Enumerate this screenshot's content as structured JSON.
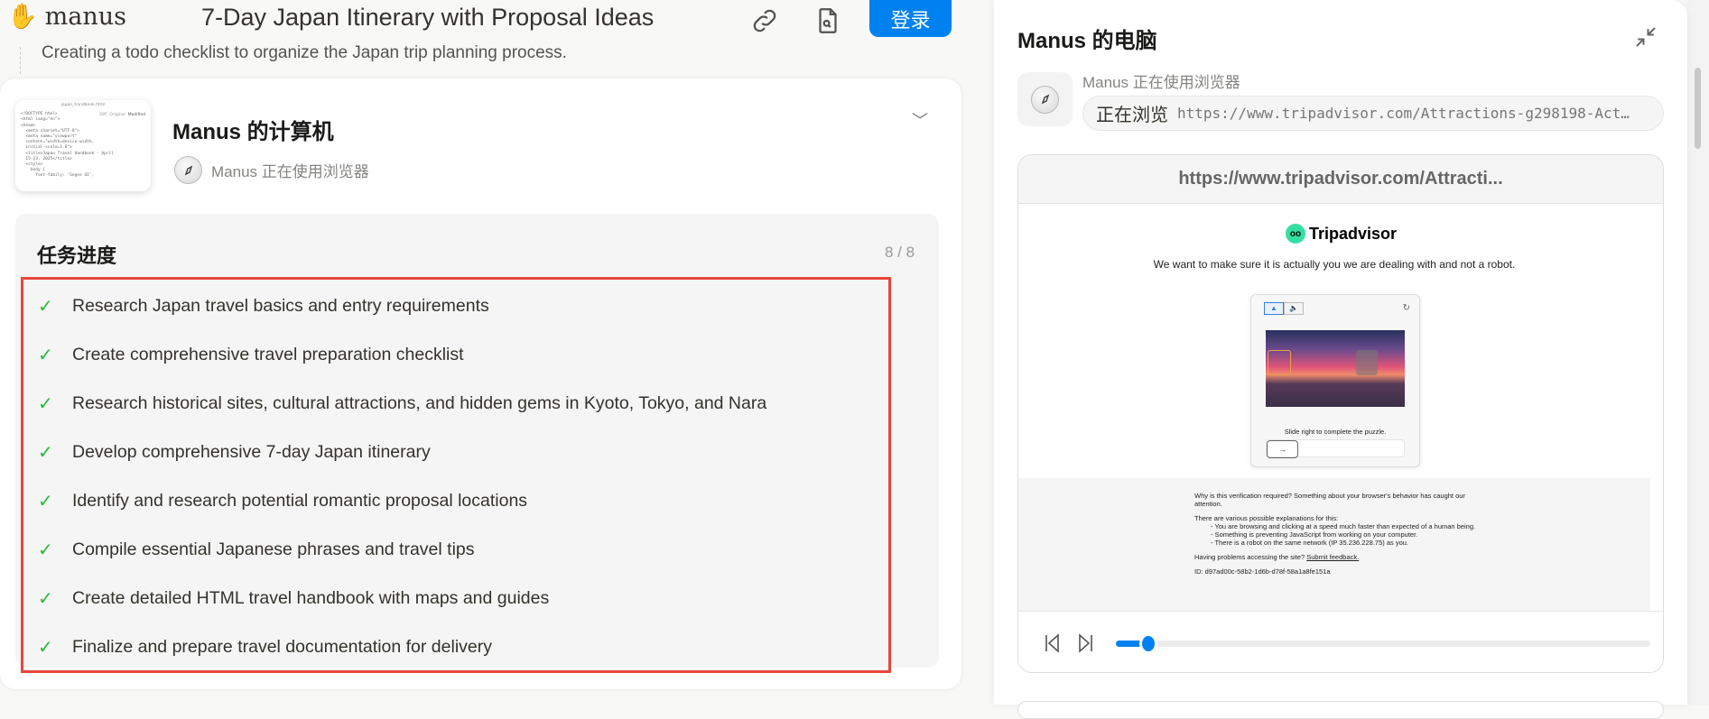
{
  "header": {
    "logo_text": "manus",
    "title": "7-Day Japan Itinerary with Proposal Ideas",
    "login_label": "登录",
    "status_line": "Creating a todo checklist to organize the Japan trip planning process."
  },
  "computer_card": {
    "title": "Manus 的计算机",
    "subtitle": "Manus 正在使用浏览器",
    "thumbnail": {
      "filename": "japan_handbook.html",
      "tabs": [
        "Diff",
        "Original",
        "Modified"
      ],
      "code": [
        "<!DOCTYPE html>",
        "<html lang=\"en\">",
        "<head>",
        "  <meta charset=\"UTF-8\">",
        "  <meta name=\"viewport\"",
        "  content=\"width=device-width,",
        "  initial-scale=1.0\">",
        "  <title>Japan Travel Handbook - April",
        "  15-23, 2025</title>",
        "  <style>",
        "    body {",
        "      font-family: 'Segoe UI',"
      ]
    }
  },
  "progress": {
    "title": "任务进度",
    "count": "8 / 8",
    "items": [
      {
        "label": "Research Japan travel basics and entry requirements",
        "done": true
      },
      {
        "label": "Create comprehensive travel preparation checklist",
        "done": true
      },
      {
        "label": "Research historical sites, cultural attractions, and hidden gems in Kyoto, Tokyo, and Nara",
        "done": true
      },
      {
        "label": "Develop comprehensive 7-day Japan itinerary",
        "done": true
      },
      {
        "label": "Identify and research potential romantic proposal locations",
        "done": true
      },
      {
        "label": "Compile essential Japanese phrases and travel tips",
        "done": true
      },
      {
        "label": "Create detailed HTML travel handbook with maps and guides",
        "done": true
      },
      {
        "label": "Finalize and prepare travel documentation for delivery",
        "done": true
      }
    ]
  },
  "right_panel": {
    "title": "Manus 的电脑",
    "status": "Manus 正在使用浏览器",
    "action": "正在浏览",
    "url": "https://www.tripadvisor.com/Attractions-g298198-Act…",
    "browser": {
      "bar_url": "https://www.tripadvisor.com/Attracti...",
      "brand": "Tripadvisor",
      "headline": "We want to make sure it is actually you we are dealing with and not a robot.",
      "slide_hint": "Slide right to complete the puzzle.",
      "why": "Why is this verification required? Something about your browser's behavior has caught our attention.",
      "explanations_intro": "There are various possible explanations for this:",
      "explanations": [
        "- You are browsing and clicking at a speed much faster than expected of a human being.",
        "- Something is preventing JavaScript from working on your computer.",
        "- There is a robot on the same network (IP 35.236.228.75) as you."
      ],
      "problems": "Having problems accessing the site?",
      "feedback_link": "Submit feedback.",
      "id_line": "ID: d97ad00c-58b2-1d6b-d78f-58a1a8fe151a"
    },
    "playback_progress": 0.06
  },
  "colors": {
    "accent": "#0081f2",
    "check": "#25ba3b",
    "highlight": "#e8463b"
  }
}
